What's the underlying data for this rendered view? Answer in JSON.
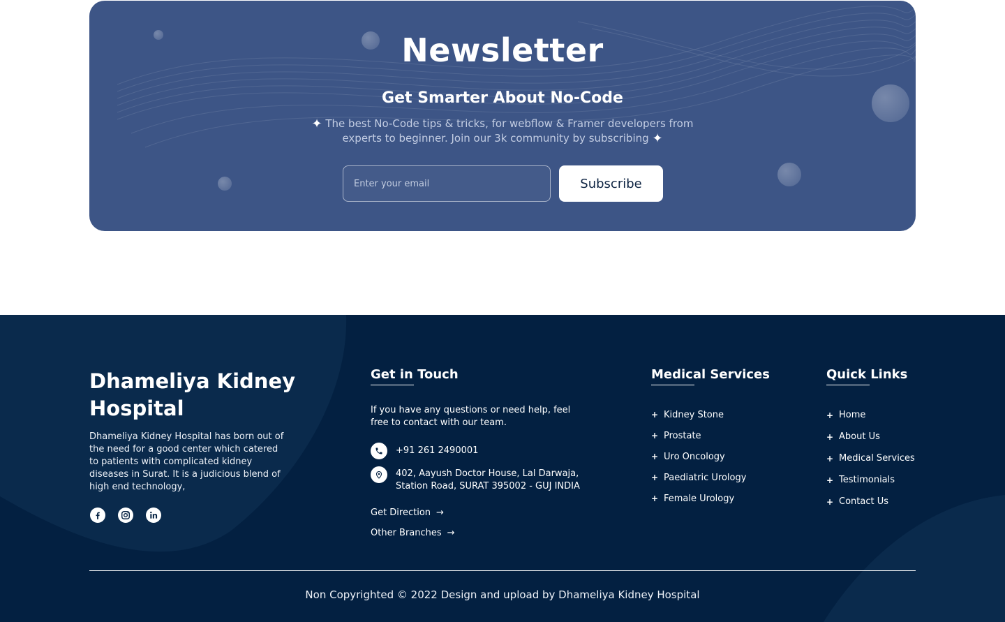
{
  "newsletter": {
    "title": "Newsletter",
    "subtitle": "Get Smarter About No-Code",
    "description": "The best No-Code tips & tricks, for webflow & Framer developers from experts to beginner. Join our 3k community by subscribing",
    "email_placeholder": "Enter your email",
    "subscribe_label": "Subscribe"
  },
  "footer": {
    "hospital_name": "Dhameliya Kidney Hospital",
    "about": "Dhameliya Kidney Hospital has born out of the need for a good center which catered to patients with complicated kidney diseases in Surat. It is a judicious blend of high end technology,",
    "socials": [
      "facebook-icon",
      "instagram-icon",
      "linkedin-icon"
    ],
    "get_in_touch": {
      "title": "Get in Touch",
      "description": "If you have any questions or need help, feel free to contact with our team.",
      "phone": "+91 261 2490001",
      "address": "402, Aayush Doctor House, Lal Darwaja, Station Road, SURAT 395002 - GUJ INDIA",
      "direction_label": "Get Direction",
      "branches_label": "Other Branches"
    },
    "medical_services": {
      "title": "Medical Services",
      "items": [
        "Kidney Stone",
        "Prostate",
        "Uro Oncology",
        "Paediatric Urology",
        "Female Urology"
      ]
    },
    "quick_links": {
      "title": "Quick Links",
      "items": [
        "Home",
        "About Us",
        "Medical Services",
        "Testimonials",
        "Contact Us"
      ]
    },
    "copyright": "Non Copyrighted © 2022 Design and upload by Dhameliya Kidney Hospital"
  },
  "colors": {
    "newsletter_bg": "#3d5586",
    "footer_bg": "#032041",
    "button_text": "#0d2342"
  }
}
